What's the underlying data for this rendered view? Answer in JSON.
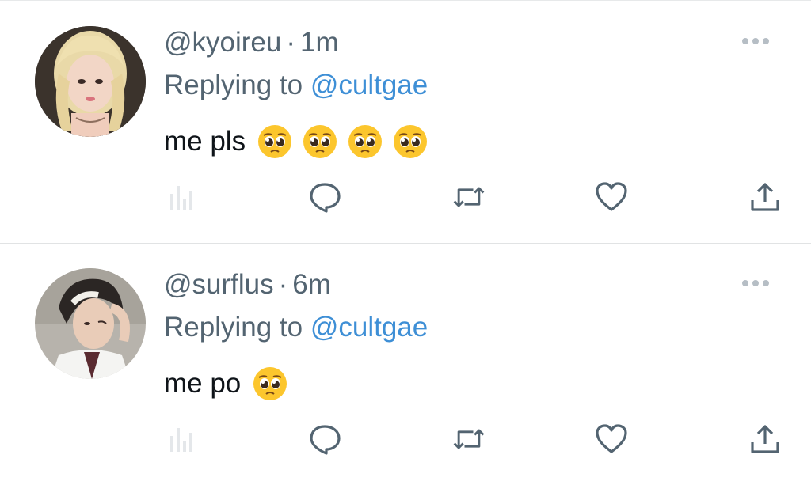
{
  "tweets": [
    {
      "handle": "@kyoireu",
      "separator": "·",
      "time": "1m",
      "replying_prefix": "Replying to",
      "replying_to": "@cultgae",
      "text": "me pls",
      "emojis": [
        "pleading-face",
        "pleading-face",
        "pleading-face",
        "pleading-face"
      ]
    },
    {
      "handle": "@surflus",
      "separator": "·",
      "time": "6m",
      "replying_prefix": "Replying to",
      "replying_to": "@cultgae",
      "text": "me po",
      "emojis": [
        "pleading-face"
      ]
    }
  ],
  "icons": {
    "more": "more-horizontal-icon",
    "analytics": "analytics-bars-icon",
    "reply": "reply-bubble-icon",
    "retweet": "retweet-icon",
    "like": "heart-icon",
    "share": "share-upload-icon"
  },
  "colors": {
    "secondary_text": "#536471",
    "mention": "#3e8fd6",
    "icon": "#536471",
    "divider": "#e1e3e4"
  }
}
